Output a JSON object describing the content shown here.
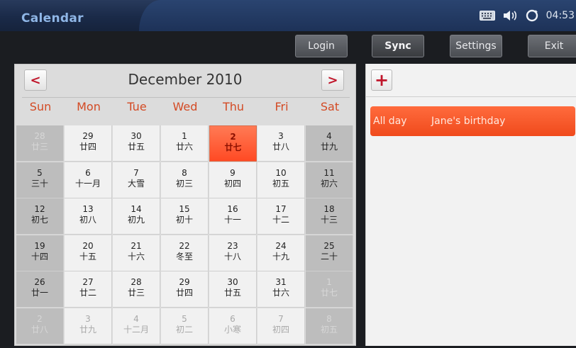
{
  "app": {
    "title": "Calendar"
  },
  "status": {
    "time": "04:53"
  },
  "toolbar": {
    "login": "Login",
    "sync": "Sync",
    "settings": "Settings",
    "exit": "Exit"
  },
  "calendar": {
    "prev": "<",
    "next": ">",
    "month_title": "December  2010",
    "weekdays": [
      "Sun",
      "Mon",
      "Tue",
      "Wed",
      "Thu",
      "Fri",
      "Sat"
    ],
    "weeks": [
      [
        [
          "28",
          "廿三"
        ],
        [
          "29",
          "廿四"
        ],
        [
          "30",
          "廿五"
        ],
        [
          "1",
          "廿六"
        ],
        [
          "2",
          "廿七"
        ],
        [
          "3",
          "廿八"
        ],
        [
          "4",
          "廿九"
        ]
      ],
      [
        [
          "5",
          "三十"
        ],
        [
          "6",
          "十一月"
        ],
        [
          "7",
          "大雪"
        ],
        [
          "8",
          "初三"
        ],
        [
          "9",
          "初四"
        ],
        [
          "10",
          "初五"
        ],
        [
          "11",
          "初六"
        ]
      ],
      [
        [
          "12",
          "初七"
        ],
        [
          "13",
          "初八"
        ],
        [
          "14",
          "初九"
        ],
        [
          "15",
          "初十"
        ],
        [
          "16",
          "十一"
        ],
        [
          "17",
          "十二"
        ],
        [
          "18",
          "十三"
        ]
      ],
      [
        [
          "19",
          "十四"
        ],
        [
          "20",
          "十五"
        ],
        [
          "21",
          "十六"
        ],
        [
          "22",
          "冬至"
        ],
        [
          "23",
          "十八"
        ],
        [
          "24",
          "十九"
        ],
        [
          "25",
          "二十"
        ]
      ],
      [
        [
          "26",
          "廿一"
        ],
        [
          "27",
          "廿二"
        ],
        [
          "28",
          "廿三"
        ],
        [
          "29",
          "廿四"
        ],
        [
          "30",
          "廿五"
        ],
        [
          "31",
          "廿六"
        ],
        [
          "1",
          "廿七"
        ]
      ],
      [
        [
          "2",
          "廿八"
        ],
        [
          "3",
          "廿九"
        ],
        [
          "4",
          "十二月"
        ],
        [
          "5",
          "初二"
        ],
        [
          "6",
          "小寒"
        ],
        [
          "7",
          "初四"
        ],
        [
          "8",
          "初五"
        ]
      ]
    ]
  },
  "events": {
    "add": "+",
    "items": [
      {
        "time": "All day",
        "title": "Jane's birthday"
      }
    ]
  }
}
